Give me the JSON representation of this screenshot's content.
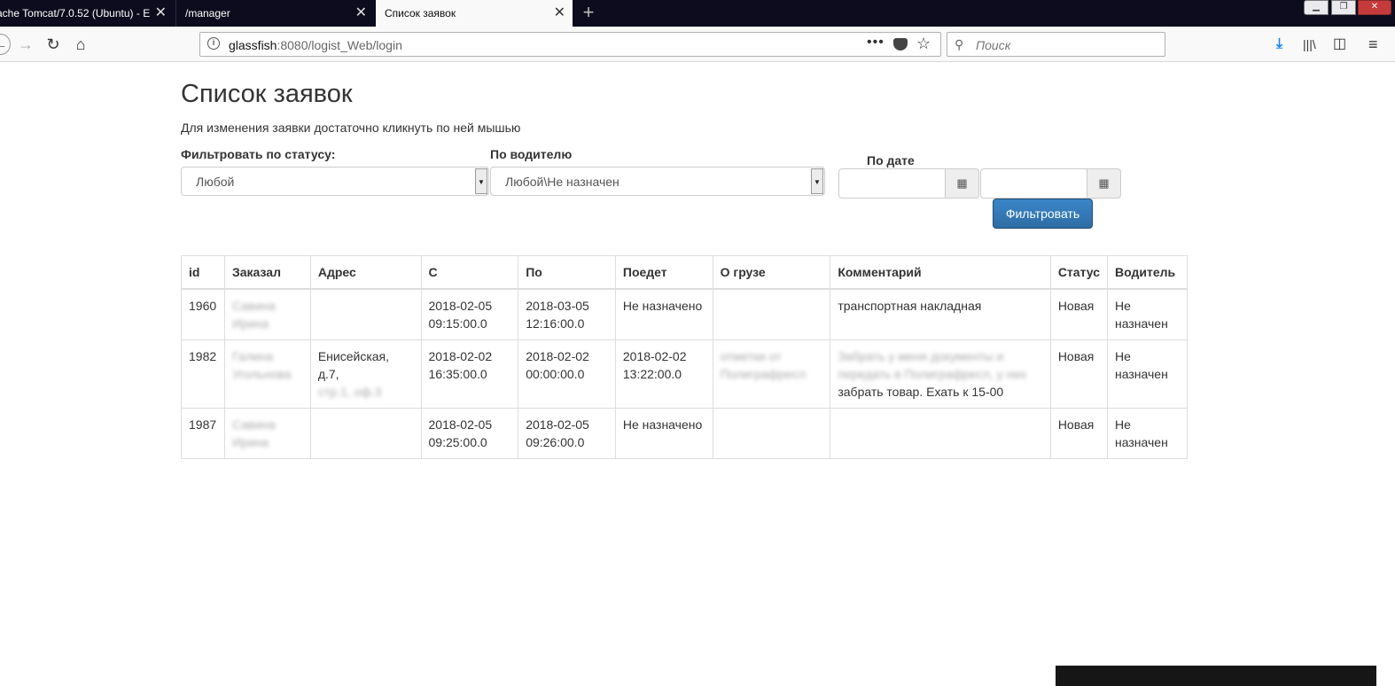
{
  "browser": {
    "tabs": [
      {
        "label": "ache Tomcat/7.0.52 (Ubuntu) - E"
      },
      {
        "label": "/manager"
      },
      {
        "label": "Список заявок"
      }
    ],
    "url_host": "glassfish",
    "url_rest": ":8080/logist_Web/login",
    "search_placeholder": "Поиск"
  },
  "page": {
    "title": "Список заявок",
    "hint": "Для изменения заявки достаточно кликнуть по ней мышью"
  },
  "filters": {
    "status_label": "Фильтровать по статусу:",
    "status_value": "Любой",
    "driver_label": "По водителю",
    "driver_value": "Любой\\Не назначен",
    "date_label": "По дате",
    "date_from": "",
    "date_to": "",
    "filter_button": "Фильтровать"
  },
  "table": {
    "headers": [
      "id",
      "Заказал",
      "Адрес",
      "С",
      "По",
      "Поедет",
      "О грузе",
      "Комментарий",
      "Статус",
      "Водитель"
    ],
    "rows": [
      {
        "id": "1960",
        "customer": "Савина Ирина",
        "address": "",
        "from": "2018-02-05 09:15:00.0",
        "to": "2018-03-05 12:16:00.0",
        "departs": "Не назначено",
        "cargo": "",
        "comment": "транспортная накладная",
        "status": "Новая",
        "driver": "Не назначен"
      },
      {
        "id": "1982",
        "customer": "Галина Угольнова",
        "address_visible": "Енисейская, д.7,",
        "address_hidden": "стр.1, оф.3",
        "from": "2018-02-02 16:35:00.0",
        "to": "2018-02-02 00:00:00.0",
        "departs": "2018-02-02 13:22:00.0",
        "cargo": "отметки от Полиграфресл",
        "comment_hidden": "Забрать у меня документы и передать в Полиграфресл, у них",
        "comment_visible": "забрать товар. Ехать к 15-00",
        "status": "Новая",
        "driver": "Не назначен"
      },
      {
        "id": "1987",
        "customer": "Савина Ирина",
        "address": "",
        "from": "2018-02-05 09:25:00.0",
        "to": "2018-02-05 09:26:00.0",
        "departs": "Не назначено",
        "cargo": "",
        "comment": "",
        "status": "Новая",
        "driver": "Не назначен"
      }
    ]
  }
}
